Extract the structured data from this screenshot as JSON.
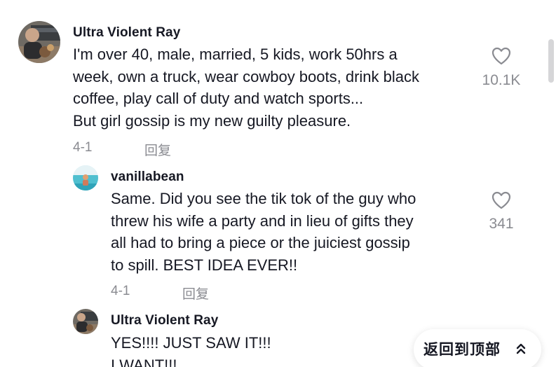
{
  "comments": [
    {
      "username": "Ultra Violent Ray",
      "text_lines": [
        "I'm over 40, male, married, 5 kids, work 50hrs a",
        "week, own a truck, wear cowboy boots, drink black",
        "coffee, play call of duty and watch sports...",
        "But girl gossip is my new guilty pleasure."
      ],
      "date": "4-1",
      "reply_label": "回复",
      "like_count": "10.1K",
      "avatar_icon": "profile-photo-man"
    },
    {
      "username": "vanillabean",
      "text_lines": [
        "Same. Did you see the tik tok of the guy who",
        "threw his wife a party and in lieu of gifts they",
        "all had to bring a piece or the juiciest gossip",
        "to spill. BEST IDEA EVER!!"
      ],
      "date": "4-1",
      "reply_label": "回复",
      "like_count": "341",
      "avatar_icon": "profile-photo-beach"
    },
    {
      "username": "Ultra Violent Ray",
      "text_lines": [
        "YES!!!! JUST SAW IT!!!",
        "I WANT!!!"
      ],
      "avatar_icon": "profile-photo-man"
    }
  ],
  "back_to_top": {
    "label": "返回到顶部",
    "icon": "double-chevron-up-icon"
  },
  "colors": {
    "text_primary": "#161823",
    "text_secondary": "#8a8b91",
    "background": "#ffffff"
  }
}
